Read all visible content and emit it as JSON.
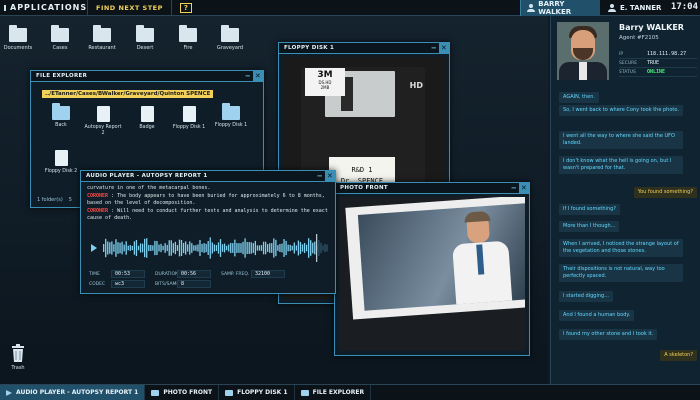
{
  "topbar": {
    "apps_label": "APPLICATIONS",
    "find_label": "FIND NEXT STEP",
    "help_label": "?",
    "users": [
      "BARRY WALKER",
      "E. TANNER"
    ],
    "clock": "17:04"
  },
  "desktop": {
    "icons": [
      "Documents",
      "Cases",
      "Restaurant",
      "Desert",
      "Fire",
      "Graveyard"
    ],
    "trash": "Trash"
  },
  "file_explorer": {
    "title": "FILE EXPLORER",
    "path": "../ETanner/Cases/BWalker/Graveyard/Quinton SPENCE",
    "items": [
      "Back",
      "Autopsy Report 2",
      "Badge",
      "Floppy Disk 1",
      "Floppy Disk 1",
      "Floppy Disk 2"
    ],
    "status_folders": "1 folder(s)",
    "status_files": "5"
  },
  "floppy": {
    "title": "FLOPPY DISK 1",
    "brand": "3M",
    "brand_sub_1": "DS.HD",
    "brand_sub_2": "2MB",
    "hd_mark": "HD",
    "label_line1": "R&D 1",
    "label_line2": "Dr. SPENCE"
  },
  "audio": {
    "title": "AUDIO PLAYER - AUTOPSY REPORT 1",
    "line0": "curvature in one of the metacarpal bones.",
    "role": "CORONER",
    "line1": " : The body appears to have been buried for approximately 6 to 8 months, based on the level of decomposition.",
    "line2": " : Will need to conduct further tests and analysis to determine the exact cause of death.",
    "fields": {
      "time_k": "TIME",
      "time_v": "00:53",
      "duration_k": "DURATION",
      "duration_v": "00:56",
      "freq_k": "SAMP. FREQ.",
      "freq_v": "32100",
      "codec_k": "CODEC",
      "codec_v": "wc3",
      "bits_k": "BITS/SAMP.",
      "bits_v": "8"
    },
    "progress": 0.946
  },
  "photo": {
    "title": "PHOTO FRONT"
  },
  "agent": {
    "name": "Barry WALKER",
    "id": "Agent #F2105",
    "ip_k": "IP",
    "ip_v": "118.111.98.27",
    "secure_k": "SECURE",
    "secure_v": "TRUE",
    "status_k": "STATUS",
    "status_v": "ONLINE"
  },
  "chat": [
    {
      "text": "AGAIN, then.",
      "dir": "in"
    },
    {
      "text": "So, I went back to where Cony took the photo.",
      "dir": "in"
    },
    {
      "text": "I went all the way to where she said the UFO landed.",
      "dir": "in"
    },
    {
      "text": "I don't know what the hell is going on, but I wasn't prepared for that.",
      "dir": "in"
    },
    {
      "text": "You found something?",
      "dir": "out"
    },
    {
      "text": "If I found something?",
      "dir": "in"
    },
    {
      "text": "More than I though...",
      "dir": "in"
    },
    {
      "text": "When I arrived, I noticed the strange layout of the vegetation and those stones.",
      "dir": "in"
    },
    {
      "text": "Their dispositions is not natural, way too perfectly spaced.",
      "dir": "in"
    },
    {
      "text": "I started digging...",
      "dir": "in"
    },
    {
      "text": "And I found a human body.",
      "dir": "in"
    },
    {
      "text": "I found my other stone and I took it.",
      "dir": "in"
    },
    {
      "text": "A skeleton?",
      "dir": "out"
    }
  ],
  "taskbar": [
    "AUDIO PLAYER - AUTOPSY REPORT 1",
    "PHOTO FRONT",
    "FLOPPY DISK 1",
    "FILE EXPLORER"
  ],
  "colors": {
    "accent": "#3b8fb4",
    "highlight": "#f2d15a",
    "alert": "#ff4747",
    "online": "#4bef7c"
  }
}
